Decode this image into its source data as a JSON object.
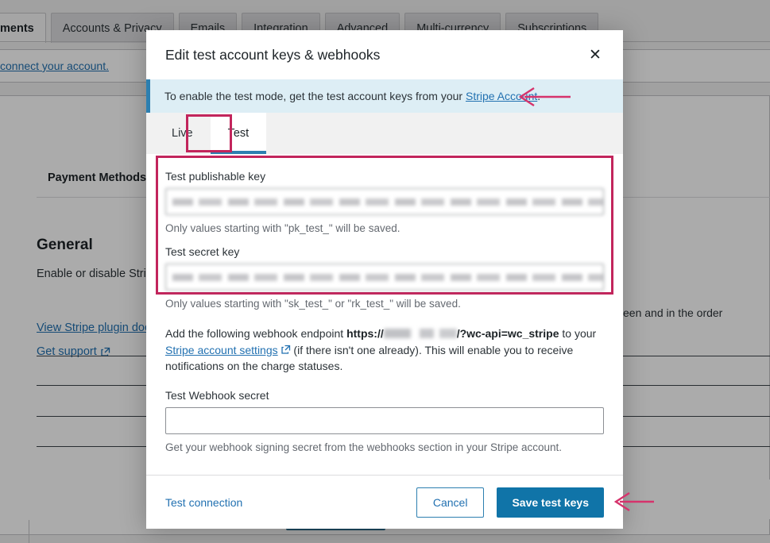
{
  "background": {
    "tabs": [
      {
        "label": "ments",
        "active": true
      },
      {
        "label": "Accounts & Privacy",
        "active": false
      },
      {
        "label": "Emails",
        "active": false
      },
      {
        "label": "Integration",
        "active": false
      },
      {
        "label": "Advanced",
        "active": false
      },
      {
        "label": "Multi-currency",
        "active": false
      },
      {
        "label": "Subscriptions",
        "active": false
      }
    ],
    "notice_link": "connect your account.",
    "section_title": "Payment Methods",
    "general_heading": "General",
    "general_paragraph": "Enable or disable Stripe on your store, enter activation keys, and turn on test mode to simulate transactions.",
    "link_docs": "View Stripe plugin docs",
    "link_support": "Get support",
    "right_text": "nfirmation screen and in the order"
  },
  "modal": {
    "title": "Edit test account keys & webhooks",
    "close_label": "✕",
    "banner": {
      "text_before": "To enable the test mode, get the test account keys from your ",
      "link_text": "Stripe Account",
      "text_after": "."
    },
    "tabs": [
      {
        "label": "Live",
        "active": false
      },
      {
        "label": "Test",
        "active": true
      }
    ],
    "fields": {
      "publishable_label": "Test publishable key",
      "publishable_value": "pk_test_51HmtGkGwNgxvfPKCLoJ8vungV9R4JQVeH7dausTtyvbNRNeKVRmNeytsoXwC7VsBCVShwimN",
      "publishable_hint": "Only values starting with \"pk_test_\" will be saved.",
      "secret_label": "Test secret key",
      "secret_value": "sk_test_51HmtGkGwNgxvfPKCLovdBTk7UfTkmH0Shtbkcwjqhim3dABLjmFLvfNcWekFUFswNlgjCpRKVTI",
      "secret_hint": "Only values starting with \"sk_test_\" or \"rk_test_\" will be saved.",
      "webhook_label": "Test Webhook secret",
      "webhook_value": "",
      "webhook_placeholder": "",
      "webhook_hint": "Get your webhook signing secret from the webhooks section in your Stripe account."
    },
    "webhook_paragraph": {
      "part1": "Add the following webhook endpoint ",
      "url_prefix": "https://",
      "url_suffix": "/?wc-api=wc_stripe",
      "part2": " to your ",
      "link_text": "Stripe account settings",
      "part3": " (if there isn't one already). This will enable you to receive notifications on the charge statuses."
    },
    "footer": {
      "test_connection": "Test connection",
      "cancel": "Cancel",
      "save": "Save test keys"
    }
  },
  "colors": {
    "accent_blue": "#1074a8",
    "banner_bg": "#ddeef5",
    "banner_bar": "#2c7fb0",
    "highlight_pink": "#c2255c",
    "link_blue": "#2271b1"
  }
}
